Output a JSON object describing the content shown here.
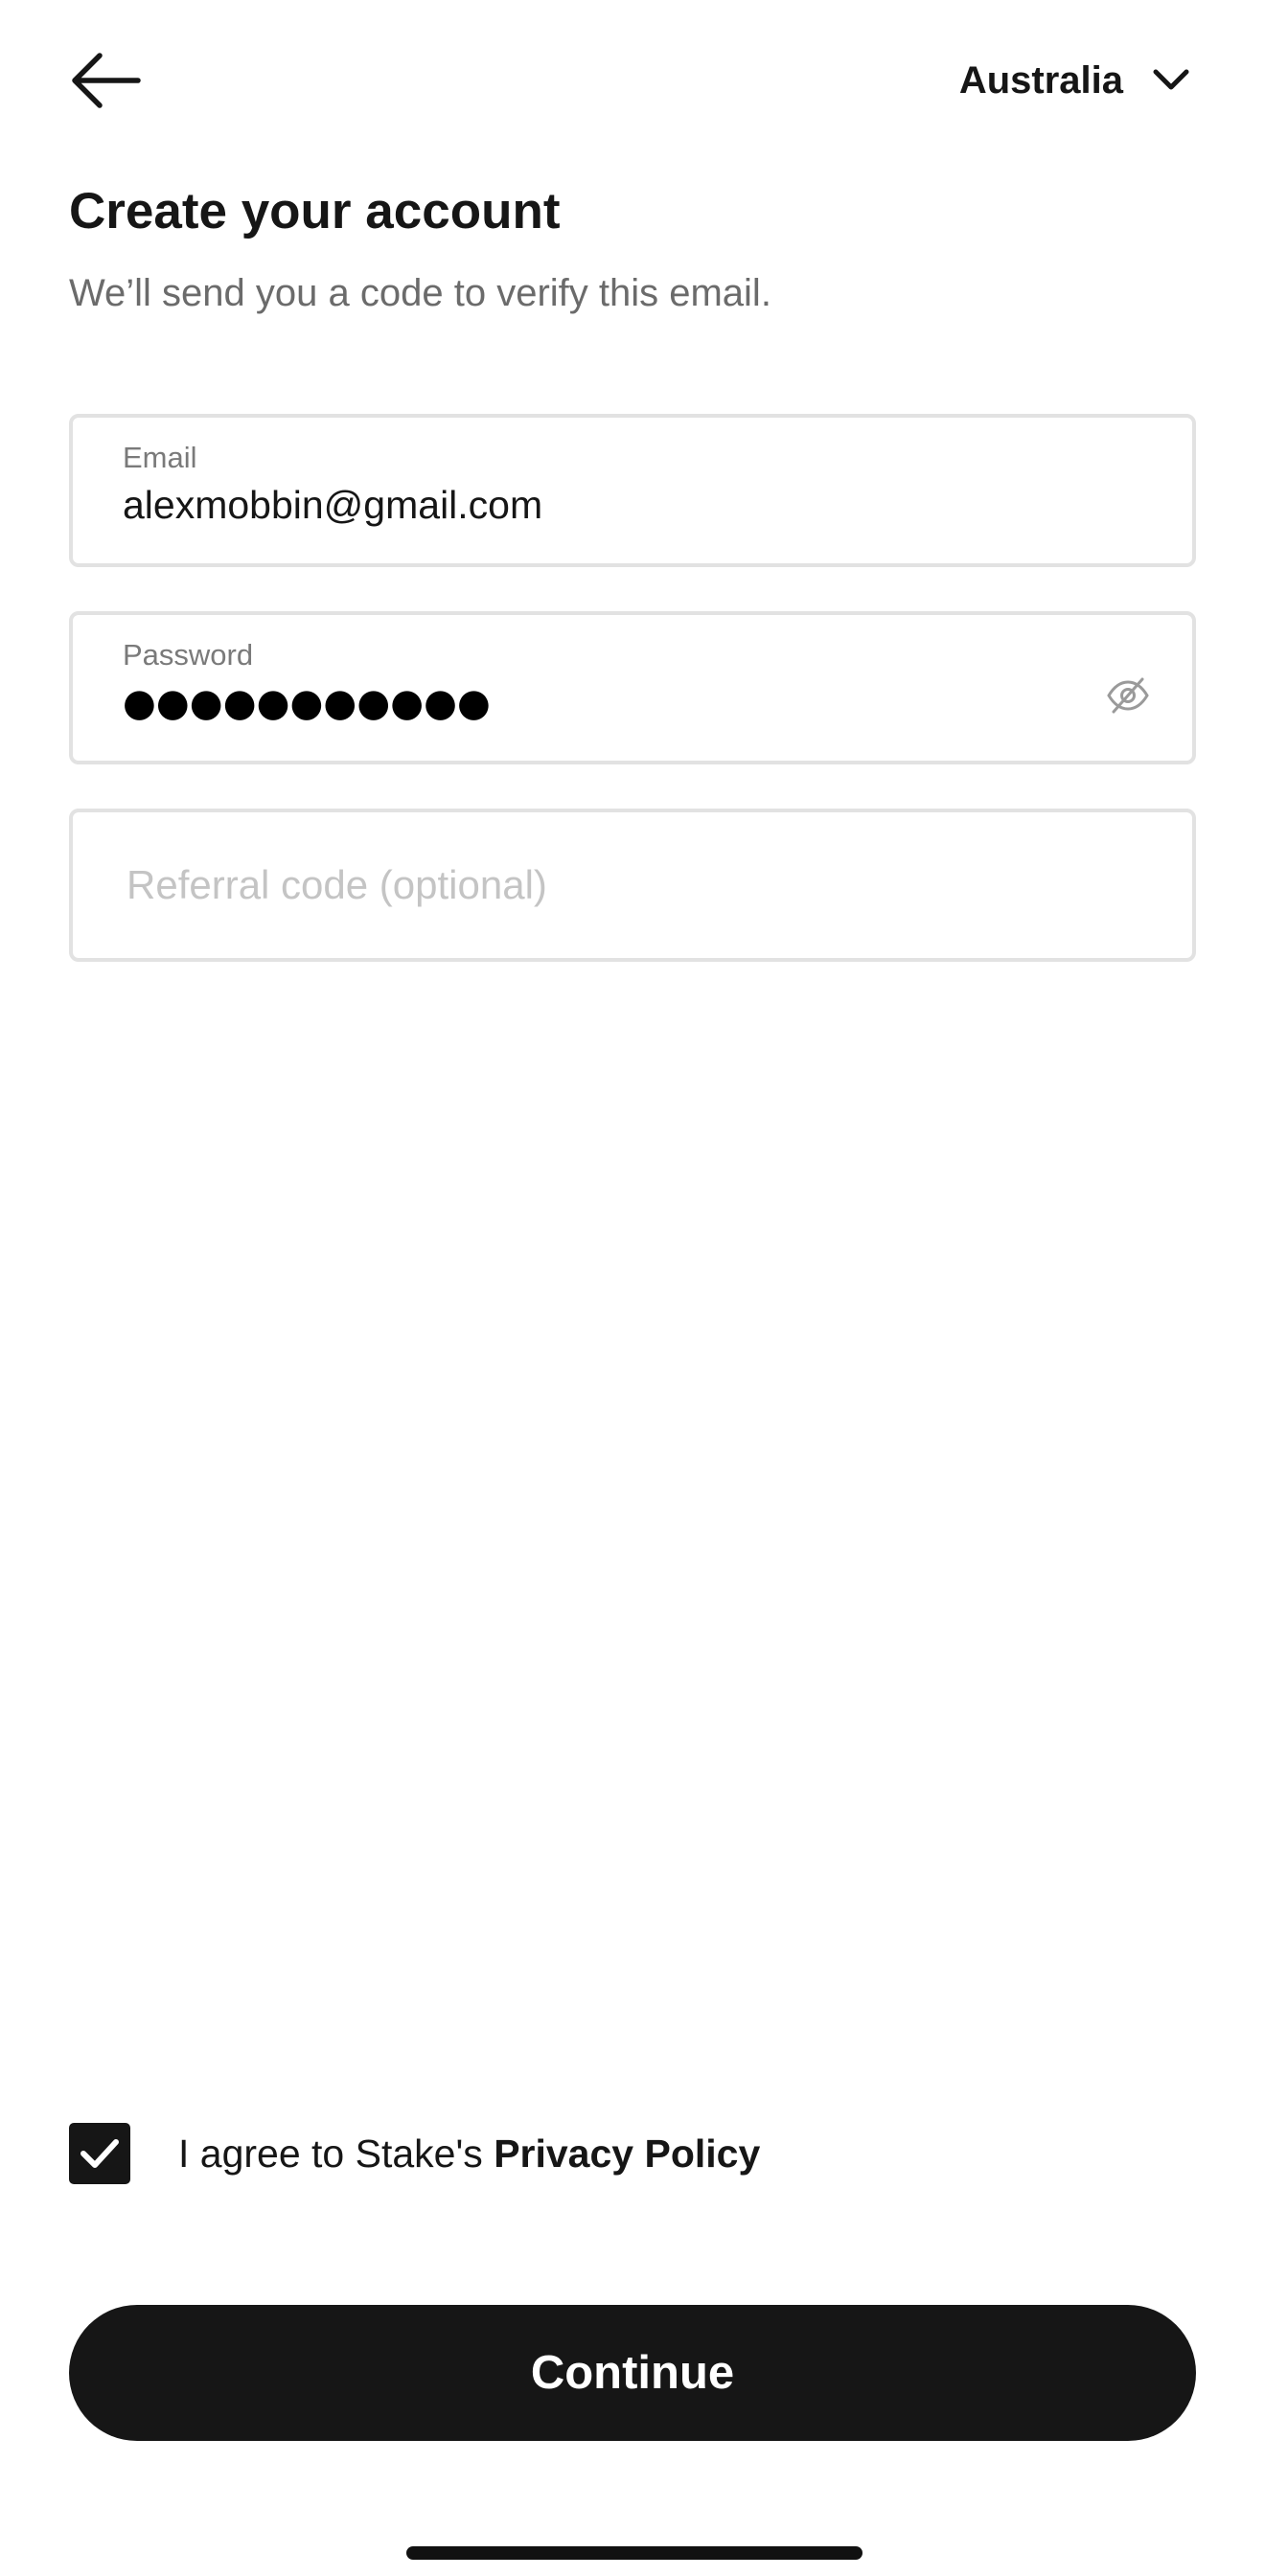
{
  "header": {
    "back_icon": "arrow-left-icon",
    "country": "Australia",
    "country_dropdown_icon": "chevron-down-icon"
  },
  "title": "Create your account",
  "subtitle": "We’ll send you a code to verify this email.",
  "form": {
    "email": {
      "label": "Email",
      "value": "alexmobbin@gmail.com"
    },
    "password": {
      "label": "Password",
      "masked_value": "●●●●●●●●●●●",
      "toggle_icon": "eye-off-icon"
    },
    "referral": {
      "placeholder": "Referral code (optional)",
      "value": ""
    }
  },
  "agreement": {
    "checked": true,
    "text": "I agree to Stake's ",
    "link": "Privacy Policy"
  },
  "continue_label": "Continue"
}
